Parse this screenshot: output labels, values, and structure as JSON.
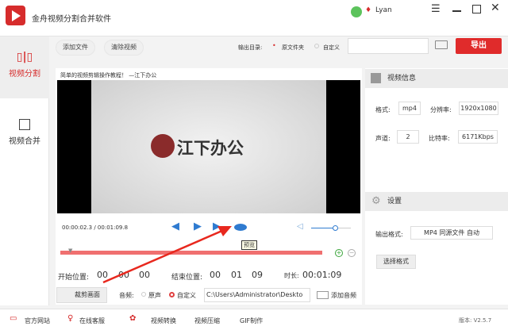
{
  "app": {
    "title": "金舟视频分割合并软件",
    "user": "Lyan"
  },
  "sidebar": {
    "items": [
      {
        "label": "视频分割",
        "active": true,
        "icon": "split-icon"
      },
      {
        "label": "视频合并",
        "active": false,
        "icon": "merge-icon"
      }
    ]
  },
  "toolbar": {
    "add_file": "添加文件",
    "clear_video": "清除视频",
    "output_dir_label": "输出目录:",
    "opt_source": "原文件夹",
    "opt_custom": "自定义",
    "output_path": "",
    "export": "导出"
  },
  "player": {
    "title": "简单的视频剪辑操作教程！ —江下办公",
    "watermark": "江下办公",
    "time": "00:00:02.3 / 00:01:09.8",
    "tooltip": "预览",
    "volume": 0.6
  },
  "trim": {
    "start_label": "开始位置:",
    "start": [
      "00",
      "00",
      "00"
    ],
    "end_label": "结束位置:",
    "end": [
      "00",
      "01",
      "09"
    ],
    "duration_label": "时长:",
    "duration": "00:01:09"
  },
  "audio": {
    "crop_button": "裁剪画面",
    "label": "音频:",
    "opt_original": "原声",
    "opt_custom": "自定义",
    "path": "C:\\Users\\Administrator\\Deskto",
    "add_audio": "添加音频"
  },
  "info": {
    "header": "视频信息",
    "format_label": "格式:",
    "format": "mp4",
    "resolution_label": "分辨率:",
    "resolution": "1920x1080",
    "channels_label": "声道:",
    "channels": "2",
    "bitrate_label": "比特率:",
    "bitrate": "6171Kbps"
  },
  "settings": {
    "header": "设置",
    "output_format_label": "输出格式:",
    "output_format": "MP4 同源文件 自动",
    "choose_format": "选择格式"
  },
  "bottom": {
    "website": "官方网站",
    "support": "在线客服",
    "convert": "视频转换",
    "compress": "视频压缩",
    "gif": "GIF制作",
    "version": "版本: V2.5.7"
  },
  "colors": {
    "accent": "#d62c2c",
    "player_blue": "#2f7bd0"
  }
}
